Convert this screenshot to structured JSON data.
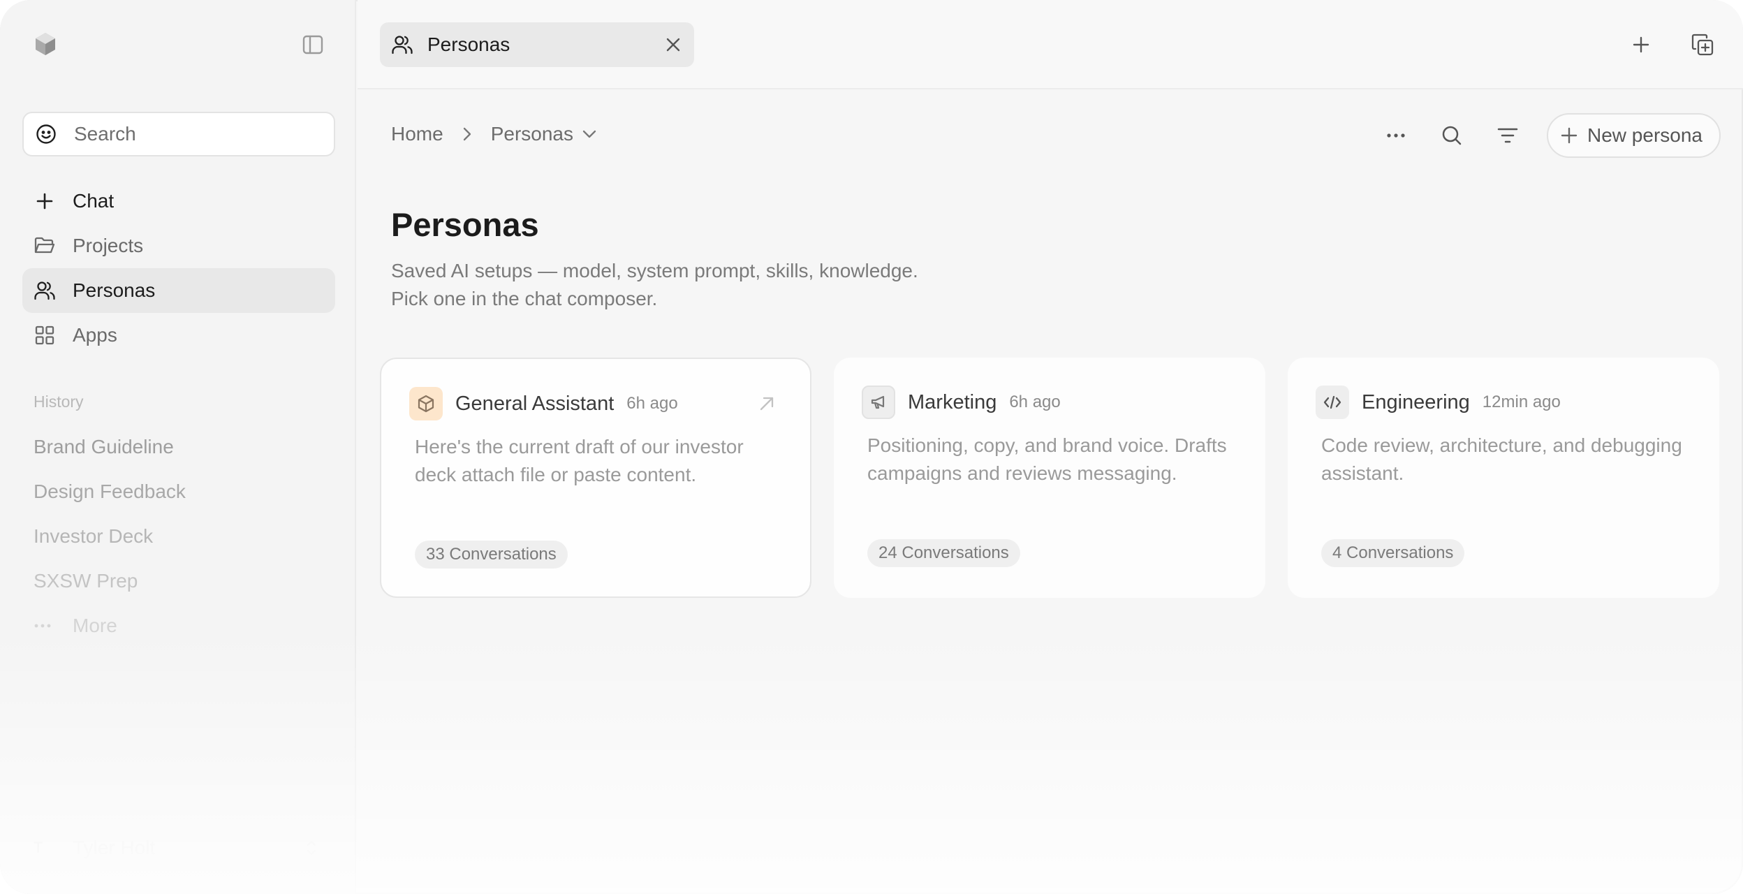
{
  "sidebar": {
    "search": {
      "placeholder": "Search"
    },
    "nav": [
      {
        "label": "Chat",
        "icon": "plus-icon"
      },
      {
        "label": "Projects",
        "icon": "folder-icon"
      },
      {
        "label": "Personas",
        "icon": "users-icon"
      },
      {
        "label": "Apps",
        "icon": "grid-icon"
      }
    ],
    "history_title": "History",
    "history": [
      "Brand Guideline",
      "Design Feedback",
      "Investor Deck",
      "SXSW Prep"
    ],
    "more_label": "More",
    "user": {
      "initial": "T",
      "name": "Tyler Holt"
    }
  },
  "topbar": {
    "tab_label": "Personas"
  },
  "main": {
    "breadcrumb": {
      "home": "Home",
      "current": "Personas"
    },
    "new_button": "New persona",
    "title": "Personas",
    "description_line1": "Saved AI setups — model, system prompt, skills, knowledge.",
    "description_line2": "Pick one in the chat composer.",
    "cards": [
      {
        "name": "General Assistant",
        "time": "6h ago",
        "desc": "Here's the current draft of our investor deck attach file or paste content.",
        "badge": "33 Conversations",
        "icon": "cube-icon",
        "icon_bg": "#fde6cc"
      },
      {
        "name": "Marketing",
        "time": "6h ago",
        "desc": "Positioning, copy, and brand voice. Drafts campaigns and reviews messaging.",
        "badge": "24 Conversations",
        "icon": "megaphone-icon",
        "icon_bg": "#eeeeee"
      },
      {
        "name": "Engineering",
        "time": "12min ago",
        "desc": "Code review, architecture, and debugging assistant.",
        "badge": "4 Conversations",
        "icon": "code-icon",
        "icon_bg": "#eeeeee"
      }
    ]
  },
  "colors": {
    "history_text": [
      "#9e9e9e",
      "#a8a8a8",
      "#b6b6b6",
      "#c4c4c4"
    ]
  }
}
